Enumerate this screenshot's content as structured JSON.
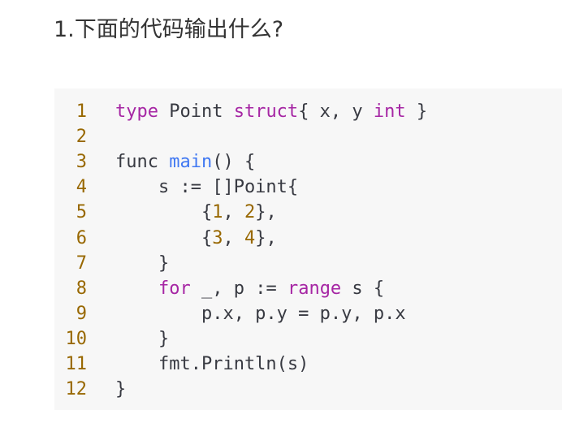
{
  "question": {
    "title": "1.下面的代码输出什么?"
  },
  "code": {
    "language": "go",
    "lines": [
      {
        "number": "1",
        "tokens": [
          {
            "t": "type",
            "c": "kw"
          },
          {
            "t": " Point "
          },
          {
            "t": "struct",
            "c": "kw"
          },
          {
            "t": "{ x, y "
          },
          {
            "t": "int",
            "c": "kw"
          },
          {
            "t": " }"
          }
        ]
      },
      {
        "number": "2",
        "tokens": []
      },
      {
        "number": "3",
        "tokens": [
          {
            "t": "func "
          },
          {
            "t": "main",
            "c": "fn"
          },
          {
            "t": "() {"
          }
        ]
      },
      {
        "number": "4",
        "tokens": [
          {
            "t": "    s := []Point{"
          }
        ]
      },
      {
        "number": "5",
        "tokens": [
          {
            "t": "        {"
          },
          {
            "t": "1",
            "c": "num"
          },
          {
            "t": ", "
          },
          {
            "t": "2",
            "c": "num"
          },
          {
            "t": "},"
          }
        ]
      },
      {
        "number": "6",
        "tokens": [
          {
            "t": "        {"
          },
          {
            "t": "3",
            "c": "num"
          },
          {
            "t": ", "
          },
          {
            "t": "4",
            "c": "num"
          },
          {
            "t": "},"
          }
        ]
      },
      {
        "number": "7",
        "tokens": [
          {
            "t": "    }"
          }
        ]
      },
      {
        "number": "8",
        "tokens": [
          {
            "t": "    "
          },
          {
            "t": "for",
            "c": "kw"
          },
          {
            "t": " _, p := "
          },
          {
            "t": "range",
            "c": "kw"
          },
          {
            "t": " s {"
          }
        ]
      },
      {
        "number": "9",
        "tokens": [
          {
            "t": "        p.x, p.y = p.y, p.x"
          }
        ]
      },
      {
        "number": "10",
        "tokens": [
          {
            "t": "    }"
          }
        ]
      },
      {
        "number": "11",
        "tokens": [
          {
            "t": "    fmt.Println(s)"
          }
        ]
      },
      {
        "number": "12",
        "tokens": [
          {
            "t": "}"
          }
        ]
      }
    ],
    "colors": {
      "background": "#f7f7f7",
      "line_number": "#986801",
      "keyword": "#a626a4",
      "function": "#4078f2",
      "number": "#986801",
      "text": "#383a42"
    }
  }
}
